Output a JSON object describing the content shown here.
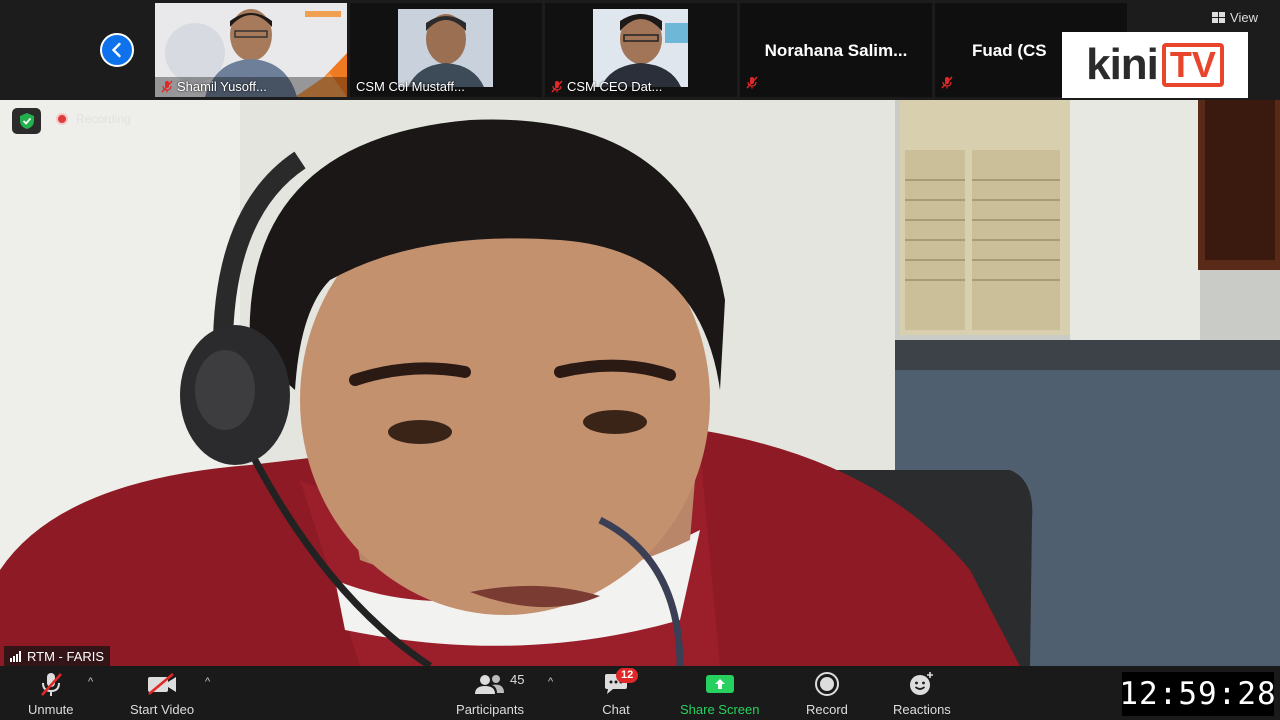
{
  "top_strip": {
    "view_label": "View",
    "tiles": [
      {
        "name": "Shamil Yusoff...",
        "muted": true
      },
      {
        "name": "CSM Col Mustaff...",
        "muted": false
      },
      {
        "name": "CSM CEO Dat...",
        "muted": true
      },
      {
        "name": "Norahana  Salim...",
        "muted": true
      },
      {
        "name": "Fuad (CS",
        "muted": true
      }
    ]
  },
  "logo": {
    "kini": "kini",
    "tv": "TV"
  },
  "main": {
    "recording_label": "Recording",
    "speaker_name": "RTM - FARIS"
  },
  "toolbar": {
    "unmute_label": "Unmute",
    "start_video_label": "Start Video",
    "participants_label": "Participants",
    "participants_count": "45",
    "chat_label": "Chat",
    "chat_badge": "12",
    "share_label": "Share Screen",
    "record_label": "Record",
    "reactions_label": "Reactions",
    "caret": "^"
  },
  "clock": "12:59:28",
  "colors": {
    "accent_blue": "#0e72ed",
    "share_green": "#27d160",
    "mute_red": "#e02828",
    "kini_red": "#e8452c"
  }
}
